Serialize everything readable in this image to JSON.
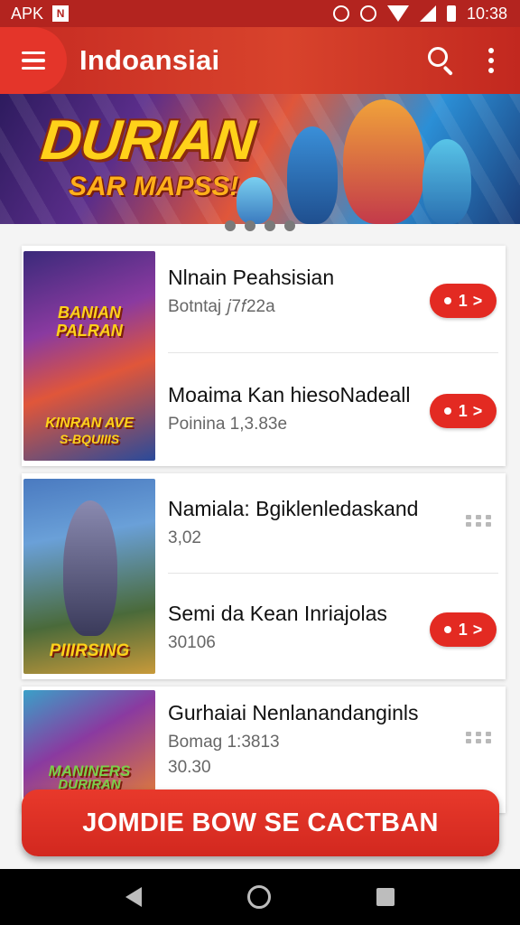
{
  "status_bar": {
    "carrier": "APK",
    "notification_icon": "N",
    "time": "10:38",
    "icons": [
      "alarm-icon",
      "vibrate-icon",
      "wifi-icon",
      "signal-icon",
      "battery-icon"
    ]
  },
  "app_bar": {
    "title": "Indoansiai",
    "icons": [
      "menu-icon",
      "search-icon",
      "more-icon"
    ]
  },
  "banner": {
    "title": "DURIAN",
    "subtitle": "SAR MAPSS!",
    "indicator_count": 4
  },
  "cards": [
    {
      "thumb_text": [
        "BANIAN",
        "PALRAN",
        "KINRAN AVE",
        "S-BQUIIIS"
      ],
      "items": [
        {
          "title": "Nlnain Peahsisian",
          "subtitle": "Botntaj 𝑗7𝑓22a",
          "action": "pill"
        },
        {
          "title": "Moaima Kan hiesoNadeall",
          "subtitle": "Poinina 1,3.83e",
          "action": "pill"
        }
      ]
    },
    {
      "thumb_text": [
        "PIIIRSING"
      ],
      "items": [
        {
          "title": "Namiala: Bgiklenledaskand",
          "subtitle": "3,02",
          "action": "grip"
        },
        {
          "title": "Semi da Kean Inriajolas",
          "subtitle": "30106",
          "action": "pill"
        }
      ]
    },
    {
      "thumb_text": [
        "MANINERS",
        "DURIRAN"
      ],
      "items": [
        {
          "title": "Gurhaiai Nenlanandanginls",
          "subtitle": "Bomag 1:3813",
          "subtitle2": "30.30",
          "action": "grip"
        }
      ]
    }
  ],
  "cta": {
    "label": "JOMDIE BOW SE CACTBAN"
  },
  "colors": {
    "primary": "#d2281f",
    "status_bar": "#b3241f",
    "pill": "#e32a22"
  },
  "nav": {
    "icons": [
      "back-icon",
      "home-icon",
      "recents-icon"
    ]
  }
}
